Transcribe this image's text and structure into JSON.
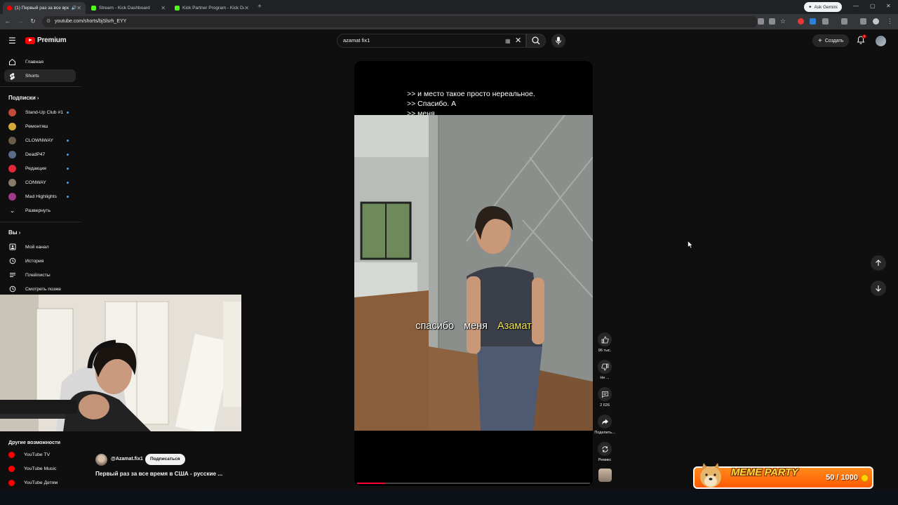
{
  "browser": {
    "tabs": [
      {
        "title": "(1) Первый раз за все вре",
        "active": true,
        "favicon_color": "#ff0000"
      },
      {
        "title": "Stream - Kick Dashboard",
        "active": false,
        "favicon_color": "#53fc18"
      },
      {
        "title": "Kick Partner Program - Kick Da",
        "active": false,
        "favicon_color": "#53fc18"
      }
    ],
    "gemini_label": "Ask Gemini",
    "url": "youtube.com/shorts/bjSlsrh_EYY"
  },
  "header": {
    "logo_text": "Premium",
    "search_value": "azamat fix1",
    "create_label": "Создать",
    "notification_count": "9"
  },
  "sidebar": {
    "main": [
      {
        "label": "Главная",
        "icon": "home-icon"
      },
      {
        "label": "Shorts",
        "icon": "shorts-icon",
        "active": true
      }
    ],
    "subscriptions_heading": "Подписки",
    "subscriptions": [
      {
        "label": "Stand-Up Club #1",
        "color": "#c24a3a",
        "dot": true
      },
      {
        "label": "Ремонтяш",
        "color": "#d4a93a",
        "dot": false
      },
      {
        "label": "CLOWNWAY",
        "color": "#6b5b4a",
        "dot": true
      },
      {
        "label": "DeadP47",
        "color": "#5a6a8a",
        "dot": true
      },
      {
        "label": "Редакция",
        "color": "#e2283a",
        "dot": true
      },
      {
        "label": "CONWAY",
        "color": "#8a7a6a",
        "dot": true
      },
      {
        "label": "Mad Highlights",
        "color": "#a03a8a",
        "dot": true
      }
    ],
    "expand_label": "Развернуть",
    "you_heading": "Вы",
    "you_items": [
      {
        "label": "Мой канал",
        "icon": "channel-icon"
      },
      {
        "label": "История",
        "icon": "history-icon"
      },
      {
        "label": "Плейлисты",
        "icon": "playlist-icon"
      },
      {
        "label": "Смотреть позже",
        "icon": "clock-icon"
      }
    ],
    "more_heading": "Другие возможности",
    "more_items": [
      {
        "label": "YouTube TV",
        "color": "#ff0000"
      },
      {
        "label": "YouTube Music",
        "color": "#ff0000"
      },
      {
        "label": "YouTube Детям",
        "color": "#ff0000"
      }
    ]
  },
  "video": {
    "top_caption_lines": [
      ">> и место такое просто нереальное.",
      ">> Спасибо. А",
      ">> меня"
    ],
    "subtitle_plain": "спасибо меня",
    "subtitle_highlight": "Азамат",
    "progress_fraction": 0.12,
    "channel_name": "@Azamat.fix1",
    "subscribe_label": "Подписаться",
    "title": "Первый раз за все время в США - русские ..."
  },
  "actions": {
    "likes": "96 тыс.",
    "dislike": "Не ...",
    "comments": "2 626",
    "share": "Поделить...",
    "remix": "Ремикс"
  },
  "overlay": {
    "meme_title": "MEME PARTY",
    "meme_count": "50 / 1000"
  }
}
